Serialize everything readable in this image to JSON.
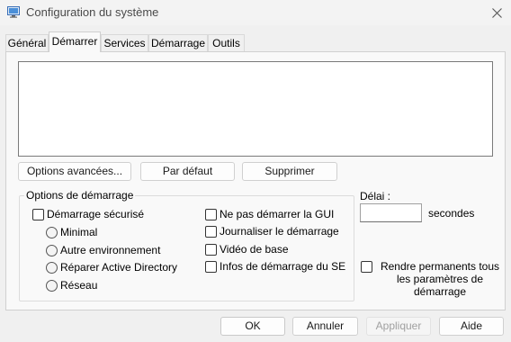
{
  "window": {
    "title": "Configuration du système",
    "icon": "msconfig-icon",
    "close_icon": "close-icon"
  },
  "tabs": [
    {
      "label": "Général",
      "active": false
    },
    {
      "label": "Démarrer",
      "active": true
    },
    {
      "label": "Services",
      "active": false
    },
    {
      "label": "Démarrage",
      "active": false
    },
    {
      "label": "Outils",
      "active": false
    }
  ],
  "boot_list": {
    "entries": []
  },
  "boot_buttons": {
    "advanced_label": "Options avancées...",
    "default_label": "Par défaut",
    "delete_label": "Supprimer"
  },
  "boot_options": {
    "title": "Options de démarrage",
    "safe_boot": {
      "label": "Démarrage sécurisé",
      "checked": false
    },
    "safe_modes": [
      {
        "label": "Minimal",
        "selected": false
      },
      {
        "label": "Autre environnement",
        "selected": false
      },
      {
        "label": "Réparer Active Directory",
        "selected": false
      },
      {
        "label": "Réseau",
        "selected": false
      }
    ],
    "right_options": [
      {
        "label": "Ne pas démarrer la GUI",
        "checked": false
      },
      {
        "label": "Journaliser le démarrage",
        "checked": false
      },
      {
        "label": "Vidéo de base",
        "checked": false
      },
      {
        "label": "Infos de démarrage du SE",
        "checked": false
      }
    ]
  },
  "timeout": {
    "label": "Délai :",
    "value": "",
    "unit": "secondes"
  },
  "permanent": {
    "label": "Rendre permanents tous les paramètres de démarrage",
    "checked": false
  },
  "footer": {
    "ok_label": "OK",
    "cancel_label": "Annuler",
    "apply_label": "Appliquer",
    "apply_enabled": false,
    "help_label": "Aide"
  }
}
